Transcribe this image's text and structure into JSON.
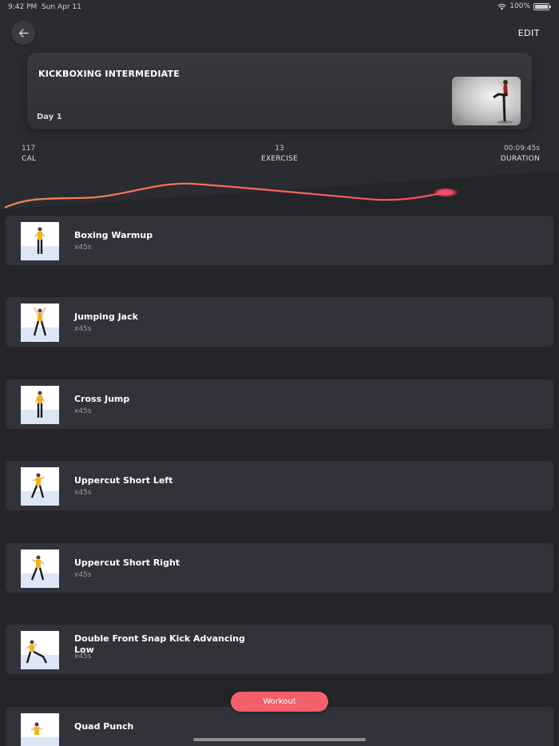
{
  "status_bar": {
    "time": "9:42 PM",
    "date": "Sun Apr 11",
    "battery": "100%"
  },
  "header": {
    "back_icon": "arrow-left-icon",
    "edit_label": "EDIT"
  },
  "program": {
    "title": "KICKBOXING INTERMEDIATE",
    "day": "Day 1"
  },
  "stats": {
    "calories": {
      "value": "117",
      "label": "CAL"
    },
    "exercises": {
      "value": "13",
      "label": "EXERCISE"
    },
    "duration": {
      "value": "00:09:45s",
      "label": "DURATION"
    }
  },
  "colors": {
    "accent": "#f35f6a",
    "curve_start": "#f08a4b",
    "curve_end": "#ff4d6a"
  },
  "exercises": [
    {
      "name": "Boxing Warmup",
      "reps": "x45s"
    },
    {
      "name": "Jumping Jack",
      "reps": "x45s"
    },
    {
      "name": "Cross Jump",
      "reps": "x45s"
    },
    {
      "name": "Uppercut Short Left",
      "reps": "x45s"
    },
    {
      "name": "Uppercut Short Right",
      "reps": "x45s"
    },
    {
      "name": "Double Front Snap Kick Advancing Low",
      "reps": "x45s"
    },
    {
      "name": "Quad Punch",
      "reps": ""
    }
  ],
  "workout_button": {
    "label": "Workout"
  }
}
